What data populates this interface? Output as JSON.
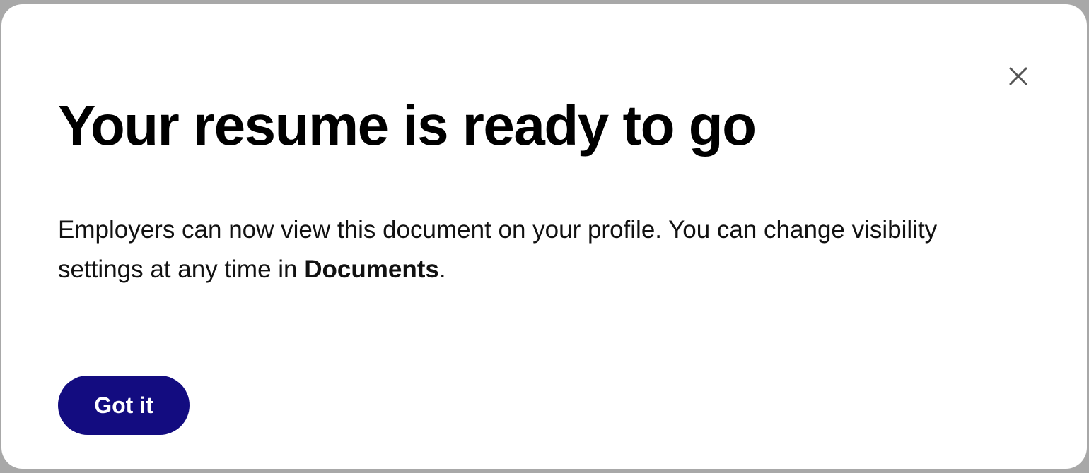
{
  "dialog": {
    "title": "Your resume is ready to go",
    "message_part1": "Employers can now view this document on your profile. You can change visibility settings at any time in ",
    "message_link": "Documents",
    "message_part2": ".",
    "primary_button_label": "Got it",
    "close_icon": "close-icon"
  },
  "colors": {
    "primary_button_bg": "#130c80",
    "backdrop": "#a8a8a8",
    "dialog_bg": "#ffffff",
    "text": "#000000",
    "close_icon": "#555555"
  }
}
